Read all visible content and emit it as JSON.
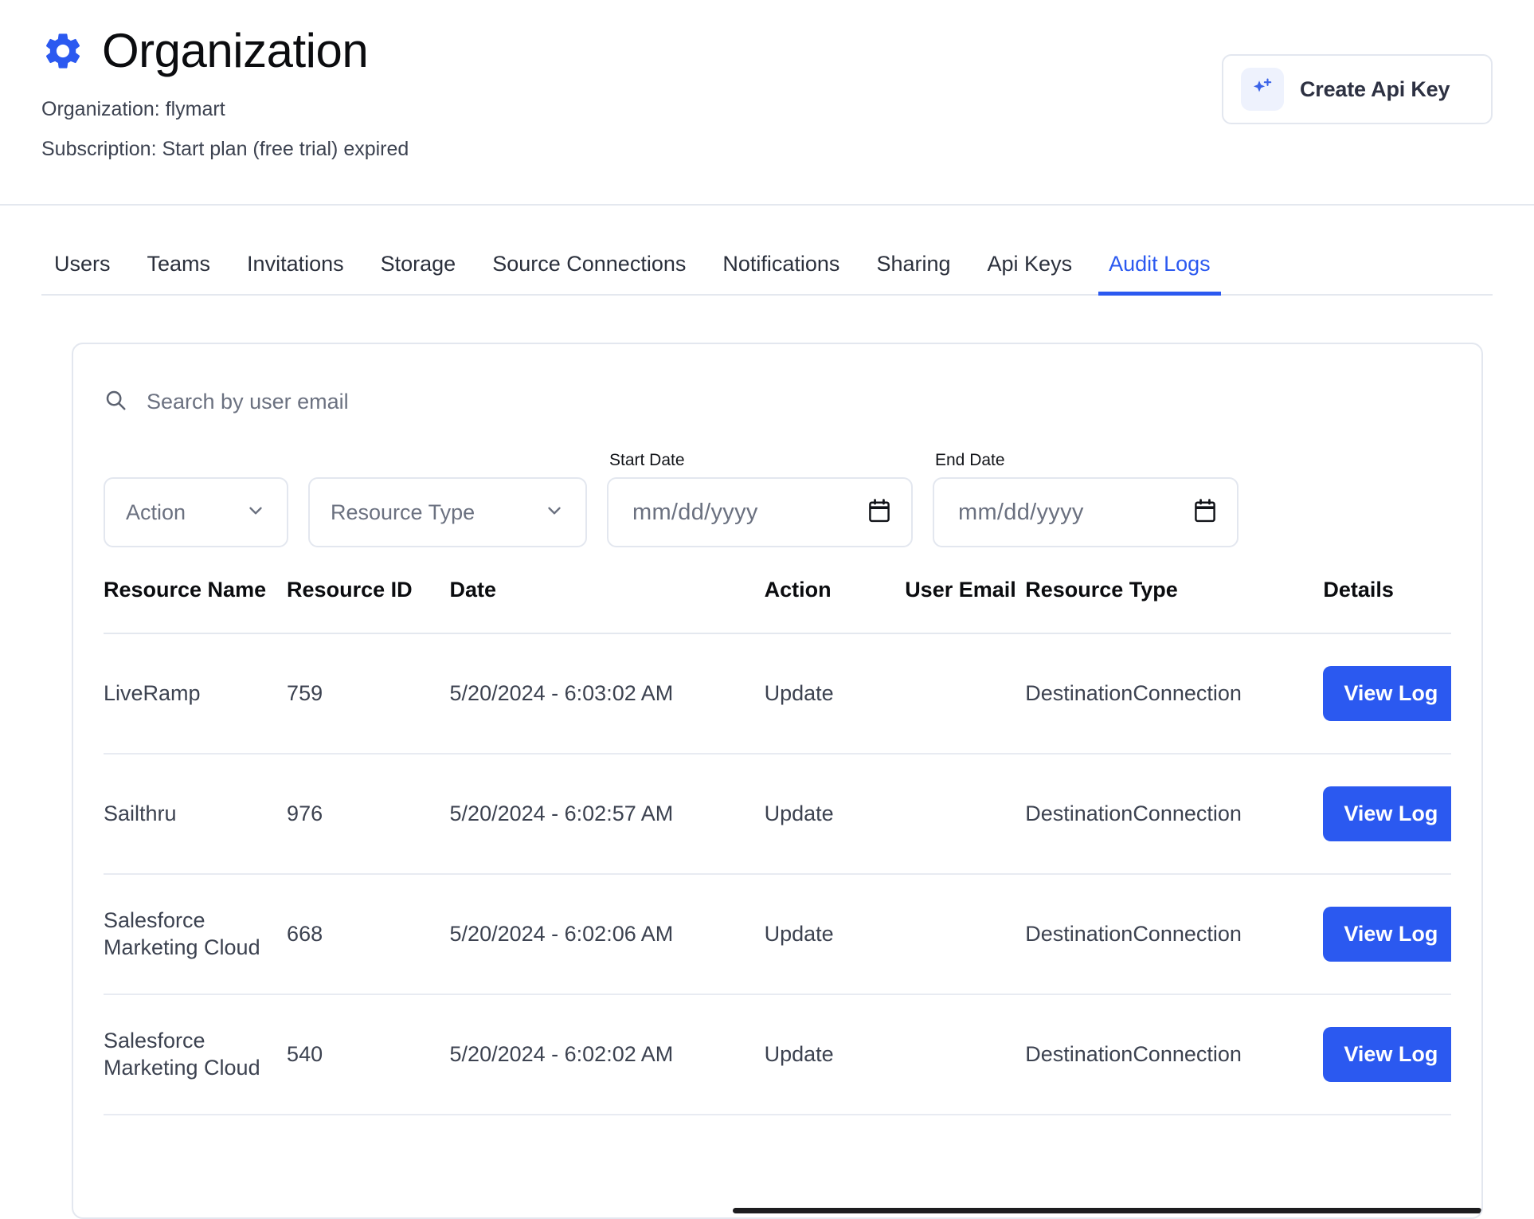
{
  "header": {
    "title": "Organization",
    "gear_icon": "gear-icon",
    "organization_line": "Organization: flymart",
    "subscription_line": "Subscription: Start plan (free trial) expired",
    "create_api_key_label": "Create Api Key",
    "create_api_key_icon": "sparkle-plus-icon",
    "accent_color": "#2b59f0"
  },
  "tabs": [
    {
      "label": "Users",
      "active": false
    },
    {
      "label": "Teams",
      "active": false
    },
    {
      "label": "Invitations",
      "active": false
    },
    {
      "label": "Storage",
      "active": false
    },
    {
      "label": "Source Connections",
      "active": false
    },
    {
      "label": "Notifications",
      "active": false
    },
    {
      "label": "Sharing",
      "active": false
    },
    {
      "label": "Api Keys",
      "active": false
    },
    {
      "label": "Audit Logs",
      "active": true
    }
  ],
  "filters": {
    "search": {
      "placeholder": "Search by user email",
      "value": "",
      "icon": "search-icon"
    },
    "action_select": {
      "label": "Action",
      "value": "",
      "icon": "chevron-down-icon"
    },
    "resource_type_select": {
      "label": "Resource Type",
      "value": "",
      "icon": "chevron-down-icon"
    },
    "start_date": {
      "label": "Start Date",
      "placeholder": "mm/dd/yyyy",
      "value": "",
      "icon": "calendar-icon"
    },
    "end_date": {
      "label": "End Date",
      "placeholder": "mm/dd/yyyy",
      "value": "",
      "icon": "calendar-icon"
    }
  },
  "table": {
    "columns": [
      "Resource Name",
      "Resource ID",
      "Date",
      "Action",
      "User Email",
      "Resource Type",
      "Details"
    ],
    "rows": [
      {
        "resource_name": "LiveRamp",
        "resource_id": "759",
        "date": "5/20/2024 - 6:03:02 AM",
        "action": "Update",
        "user_email": "",
        "resource_type": "DestinationConnection",
        "details_button": "View Log"
      },
      {
        "resource_name": "Sailthru",
        "resource_id": "976",
        "date": "5/20/2024 - 6:02:57 AM",
        "action": "Update",
        "user_email": "",
        "resource_type": "DestinationConnection",
        "details_button": "View Log"
      },
      {
        "resource_name": "Salesforce Marketing Cloud",
        "resource_id": "668",
        "date": "5/20/2024 - 6:02:06 AM",
        "action": "Update",
        "user_email": "",
        "resource_type": "DestinationConnection",
        "details_button": "View Log"
      },
      {
        "resource_name": "Salesforce Marketing Cloud",
        "resource_id": "540",
        "date": "5/20/2024 - 6:02:02 AM",
        "action": "Update",
        "user_email": "",
        "resource_type": "DestinationConnection",
        "details_button": "View Log"
      }
    ]
  }
}
